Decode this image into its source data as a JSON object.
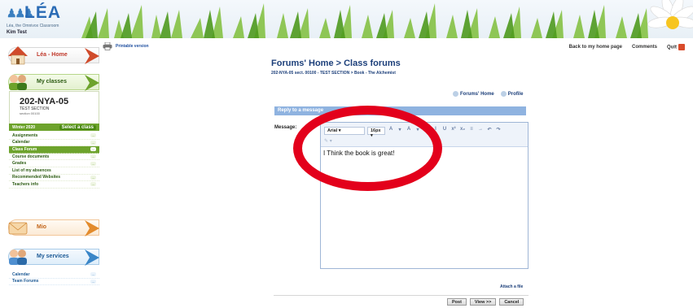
{
  "app": {
    "logo_text": "LÉA",
    "logo_subtitle": "Léa, the Omnivox Classroom",
    "user_name": "Kim Test",
    "colors": {
      "accent_green": "#6da32c",
      "title_blue": "#1c3f7a",
      "header_blue": "#8fb3e0",
      "annotation_red": "#e3001b"
    }
  },
  "topbar": {
    "printable_label": "Printable version",
    "printer_icon": "printer-icon",
    "nav": [
      "Back to my home page",
      "Comments",
      "Quit"
    ]
  },
  "sidebar": {
    "home_label": "Léa - Home",
    "classes_label": "My classes",
    "class": {
      "code": "202-NYA-05",
      "section": "TEST SECTION",
      "section_num": "section 00100"
    },
    "term": "Winter 2020",
    "select_class_label": "Select a class",
    "menu": [
      {
        "label": "Assignments",
        "count": "..."
      },
      {
        "label": "Calendar",
        "count": "..."
      },
      {
        "label": "Class Forum",
        "count": "..."
      },
      {
        "label": "Course documents",
        "count": "..."
      },
      {
        "label": "Grades",
        "count": "..."
      },
      {
        "label": "List of my absences",
        "count": ""
      },
      {
        "label": "Recommended Websites",
        "count": "..."
      },
      {
        "label": "Teachers info",
        "count": "..."
      }
    ],
    "mio_label": "Mio",
    "services_label": "My services",
    "services": [
      {
        "label": "Calendar",
        "count": "..."
      },
      {
        "label": "Team Forums",
        "count": "..."
      }
    ]
  },
  "main": {
    "title": "Forums' Home > Class forums",
    "breadcrumb": "202-NYA-05 sect. 00100 - TEST SECTION > Book - The Alchemist",
    "forums_home_link": "Forums' Home",
    "profile_link": "Profile",
    "section_header": "Reply to a message",
    "message_label": "Message:",
    "editor": {
      "font": "Arial",
      "size": "16px",
      "toolbar_buttons": [
        "A",
        "▾",
        "A",
        "▾",
        "B",
        "I",
        "U",
        "x²",
        "x₂",
        "≡",
        "→",
        "↶",
        "↷"
      ],
      "content": "I Think the book is great!"
    },
    "attach_label": "Attach a file",
    "buttons": {
      "post": "Post",
      "view": "View >>",
      "cancel": "Cancel"
    }
  }
}
